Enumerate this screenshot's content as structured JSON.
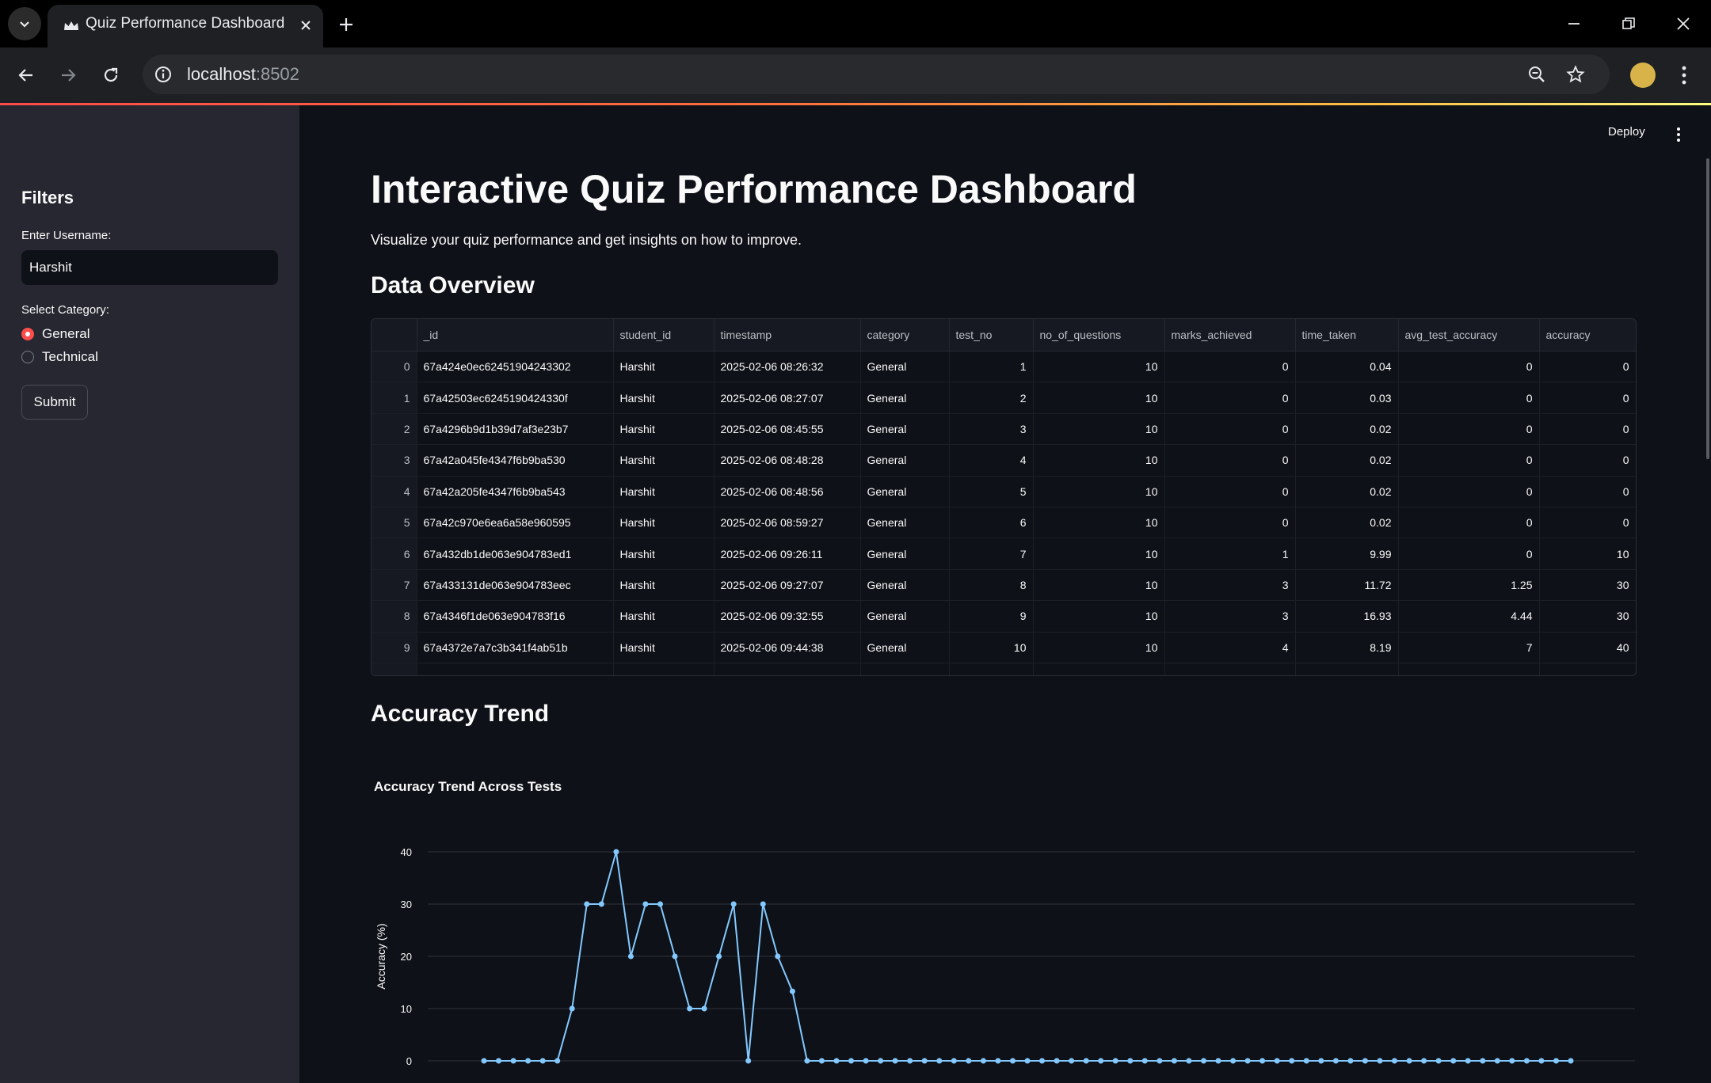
{
  "browser": {
    "tab_title": "Quiz Performance Dashboard",
    "url_host": "localhost",
    "url_port": ":8502"
  },
  "sidebar": {
    "title": "Filters",
    "username_label": "Enter Username:",
    "username_value": "Harshit",
    "category_label": "Select Category:",
    "options": [
      {
        "label": "General",
        "selected": true
      },
      {
        "label": "Technical",
        "selected": false
      }
    ],
    "submit_label": "Submit"
  },
  "header": {
    "deploy_label": "Deploy"
  },
  "main": {
    "title": "Interactive Quiz Performance Dashboard",
    "subtitle": "Visualize your quiz performance and get insights on how to improve.",
    "overview_heading": "Data Overview",
    "trend_heading": "Accuracy Trend"
  },
  "table": {
    "columns": [
      "",
      "_id",
      "student_id",
      "timestamp",
      "category",
      "test_no",
      "no_of_questions",
      "marks_achieved",
      "time_taken",
      "avg_test_accuracy",
      "accuracy"
    ],
    "rows": [
      [
        "0",
        "67a424e0ec62451904243302",
        "Harshit",
        "2025-02-06 08:26:32",
        "General",
        "1",
        "10",
        "0",
        "0.04",
        "0",
        "0"
      ],
      [
        "1",
        "67a42503ec6245190424330f",
        "Harshit",
        "2025-02-06 08:27:07",
        "General",
        "2",
        "10",
        "0",
        "0.03",
        "0",
        "0"
      ],
      [
        "2",
        "67a4296b9d1b39d7af3e23b7",
        "Harshit",
        "2025-02-06 08:45:55",
        "General",
        "3",
        "10",
        "0",
        "0.02",
        "0",
        "0"
      ],
      [
        "3",
        "67a42a045fe4347f6b9ba530",
        "Harshit",
        "2025-02-06 08:48:28",
        "General",
        "4",
        "10",
        "0",
        "0.02",
        "0",
        "0"
      ],
      [
        "4",
        "67a42a205fe4347f6b9ba543",
        "Harshit",
        "2025-02-06 08:48:56",
        "General",
        "5",
        "10",
        "0",
        "0.02",
        "0",
        "0"
      ],
      [
        "5",
        "67a42c970e6ea6a58e960595",
        "Harshit",
        "2025-02-06 08:59:27",
        "General",
        "6",
        "10",
        "0",
        "0.02",
        "0",
        "0"
      ],
      [
        "6",
        "67a432db1de063e904783ed1",
        "Harshit",
        "2025-02-06 09:26:11",
        "General",
        "7",
        "10",
        "1",
        "9.99",
        "0",
        "10"
      ],
      [
        "7",
        "67a433131de063e904783eec",
        "Harshit",
        "2025-02-06 09:27:07",
        "General",
        "8",
        "10",
        "3",
        "11.72",
        "1.25",
        "30"
      ],
      [
        "8",
        "67a4346f1de063e904783f16",
        "Harshit",
        "2025-02-06 09:32:55",
        "General",
        "9",
        "10",
        "3",
        "16.93",
        "4.44",
        "30"
      ],
      [
        "9",
        "67a4372e7a7c3b341f4ab51b",
        "Harshit",
        "2025-02-06 09:44:38",
        "General",
        "10",
        "10",
        "4",
        "8.19",
        "7",
        "40"
      ]
    ]
  },
  "colors": {
    "accent": "#ff4b4b",
    "line": "#83c9ff",
    "background": "#0e1117",
    "sidebar": "#262730"
  },
  "chart_data": {
    "type": "line",
    "title": "Accuracy Trend Across Tests",
    "xlabel": "",
    "ylabel": "Accuracy (%)",
    "ylim": [
      0,
      40
    ],
    "yticks": [
      0,
      10,
      20,
      30,
      40
    ],
    "grid": true,
    "series": [
      {
        "values": [
          0,
          0,
          0,
          0,
          0,
          0,
          10,
          30,
          30,
          40,
          20,
          30,
          30,
          20,
          10,
          10,
          20,
          30,
          0,
          30,
          20,
          13.3,
          0,
          0,
          0,
          0,
          0,
          0,
          0,
          0,
          0,
          0,
          0,
          0,
          0,
          0,
          0,
          0,
          0,
          0,
          0,
          0,
          0,
          0,
          0,
          0,
          0,
          0,
          0,
          0,
          0,
          0,
          0,
          0,
          0,
          0,
          0,
          0,
          0,
          0,
          0,
          0,
          0,
          0,
          0,
          0,
          0,
          0,
          0,
          0,
          0,
          0,
          0,
          0,
          0
        ]
      }
    ]
  }
}
